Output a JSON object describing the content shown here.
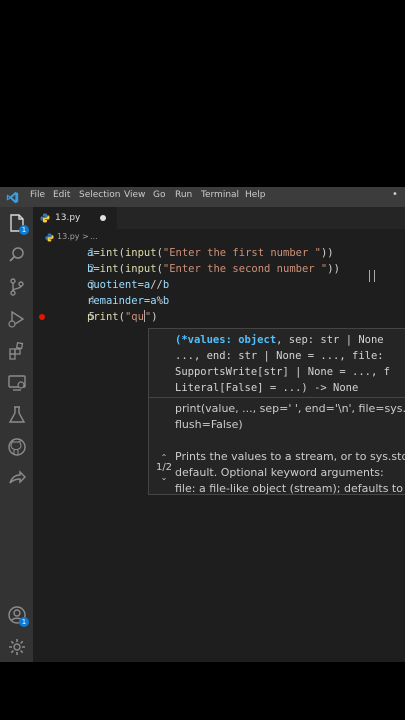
{
  "menubar": {
    "logo_icon": "vscode-logo-icon",
    "items": [
      "File",
      "Edit",
      "Selection",
      "View",
      "Go",
      "Run",
      "Terminal",
      "Help"
    ],
    "more": "•"
  },
  "activity_bar": {
    "items": [
      "explorer-icon",
      "search-icon",
      "source-control-icon",
      "run-debug-icon",
      "extensions-icon",
      "remote-explorer-icon",
      "testing-icon",
      "github-icon",
      "live-share-icon"
    ],
    "explorer_badge": "1",
    "accounts_badge": "1",
    "bottom": [
      "accounts-icon",
      "settings-gear-icon"
    ]
  },
  "tab": {
    "filename": "13.py",
    "dirty_dot": "●"
  },
  "breadcrumb": {
    "file": "13.py",
    "sep": ">",
    "rest": "..."
  },
  "editor": {
    "lines": [
      {
        "num": "1",
        "parts": [
          [
            "var",
            "a"
          ],
          [
            "op",
            "="
          ],
          [
            "fn",
            "int"
          ],
          [
            "op",
            "("
          ],
          [
            "fn",
            "input"
          ],
          [
            "op",
            "("
          ],
          [
            "str",
            "\"Enter the first number \""
          ],
          [
            "op",
            "))"
          ]
        ]
      },
      {
        "num": "2",
        "parts": [
          [
            "var",
            "b"
          ],
          [
            "op",
            "="
          ],
          [
            "fn",
            "int"
          ],
          [
            "op",
            "("
          ],
          [
            "fn",
            "input"
          ],
          [
            "op",
            "("
          ],
          [
            "str",
            "\"Enter the second number \""
          ],
          [
            "op",
            "))"
          ]
        ]
      },
      {
        "num": "3",
        "parts": [
          [
            "var",
            "quotient"
          ],
          [
            "op",
            "="
          ],
          [
            "var",
            "a"
          ],
          [
            "op",
            "//"
          ],
          [
            "var",
            "b"
          ]
        ]
      },
      {
        "num": "4",
        "parts": [
          [
            "var",
            "remainder"
          ],
          [
            "op",
            "="
          ],
          [
            "var",
            "a"
          ],
          [
            "op",
            "%"
          ],
          [
            "var",
            "b"
          ]
        ]
      },
      {
        "num": "5",
        "parts": [
          [
            "fn",
            "print"
          ],
          [
            "op",
            "("
          ],
          [
            "str",
            "\"qu\""
          ],
          [
            "op",
            ")"
          ]
        ]
      }
    ],
    "breakpoint_line": "5"
  },
  "hover": {
    "signature": [
      [
        [
          "hl",
          "(*values: object"
        ],
        [
          "txt",
          ", sep: str | None"
        ]
      ],
      [
        [
          "txt",
          "..., end: str | None = ..., file: "
        ]
      ],
      [
        [
          "txt",
          "SupportsWrite[str] | None = ..., f"
        ]
      ],
      [
        [
          "txt",
          "Literal[False] = ...) -> None"
        ]
      ]
    ],
    "doc": [
      "print(value, ..., sep=' ', end='\\n', file=sys.stdo",
      "flush=False)",
      "",
      "Prints the values to a stream, or to sys.stdo",
      "default. Optional keyword arguments:",
      "file: a file-like object (stream); defaults to th"
    ],
    "pager": "1/2",
    "nav_up": "⌃",
    "nav_down": "⌄"
  },
  "colors": {
    "accent": "#0e7ad3",
    "breakpoint": "#e51400",
    "string": "#ce9178",
    "function": "#dcdcaa",
    "variable": "#9cdcfe"
  }
}
